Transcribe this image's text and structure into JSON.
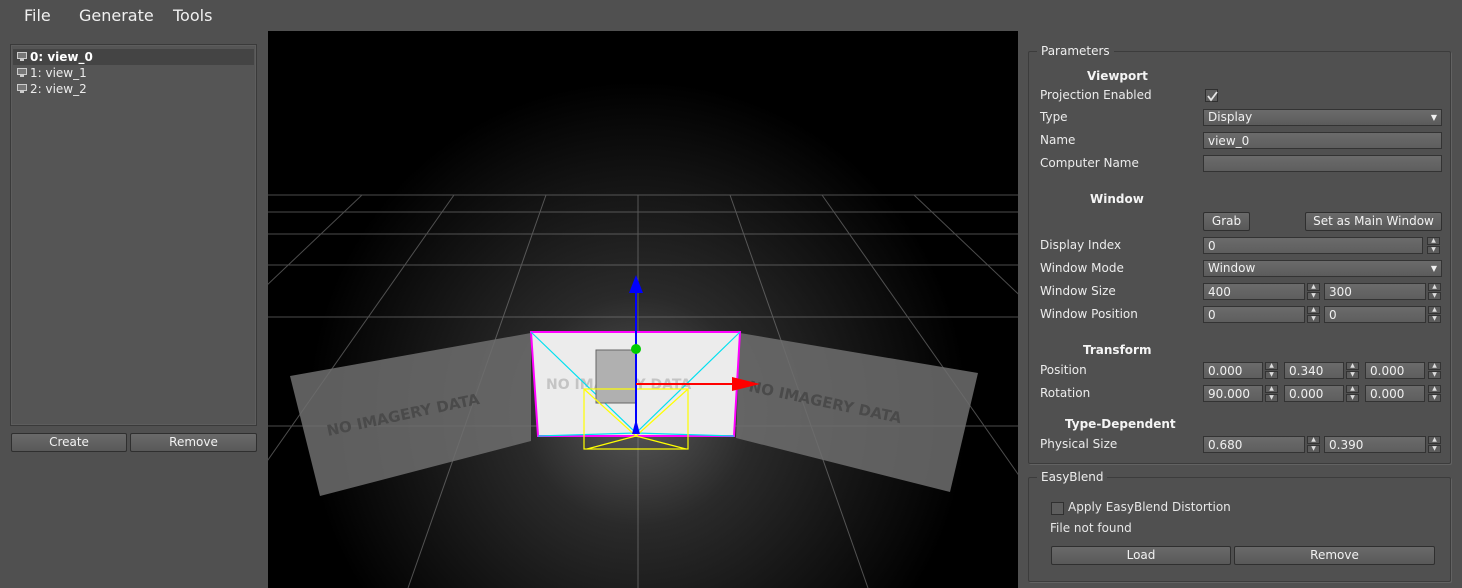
{
  "menu": {
    "file": "File",
    "generate": "Generate",
    "tools": "Tools"
  },
  "tree": {
    "items": [
      {
        "label": "0: view_0",
        "selected": true
      },
      {
        "label": "1: view_1",
        "selected": false
      },
      {
        "label": "2: view_2",
        "selected": false
      }
    ]
  },
  "left_buttons": {
    "create": "Create",
    "remove": "Remove"
  },
  "viewport": {
    "overlay_text": "NO IMAGERY DATA"
  },
  "parameters": {
    "title": "Parameters",
    "viewport_section": "Viewport",
    "projection_enabled_label": "Projection Enabled",
    "projection_enabled": true,
    "type_label": "Type",
    "type_value": "Display",
    "name_label": "Name",
    "name_value": "view_0",
    "computer_name_label": "Computer Name",
    "computer_name_value": "",
    "window_section": "Window",
    "grab_button": "Grab",
    "set_main_button": "Set as Main Window",
    "display_index_label": "Display Index",
    "display_index_value": "0",
    "window_mode_label": "Window Mode",
    "window_mode_value": "Window",
    "window_size_label": "Window Size",
    "window_size_w": "400",
    "window_size_h": "300",
    "window_position_label": "Window Position",
    "window_position_x": "0",
    "window_position_y": "0",
    "transform_section": "Transform",
    "position_label": "Position",
    "position_x": "0.000",
    "position_y": "0.340",
    "position_z": "0.000",
    "rotation_label": "Rotation",
    "rotation_x": "90.000",
    "rotation_y": "0.000",
    "rotation_z": "0.000",
    "type_dependent_section": "Type-Dependent",
    "physical_size_label": "Physical Size",
    "physical_size_w": "0.680",
    "physical_size_h": "0.390"
  },
  "easyblend": {
    "title": "EasyBlend",
    "apply_label": "Apply EasyBlend Distortion",
    "apply_checked": false,
    "status": "File not found",
    "load_button": "Load",
    "remove_button": "Remove"
  },
  "colors": {
    "background": "#505050",
    "viewport_bg": "#000000",
    "axis_x": "#ff0000",
    "axis_y": "#00cc00",
    "axis_z": "#0000ff",
    "frustum": "#ffff00",
    "projection_lines": "#00ffff",
    "selection_border": "#ff00ff"
  }
}
